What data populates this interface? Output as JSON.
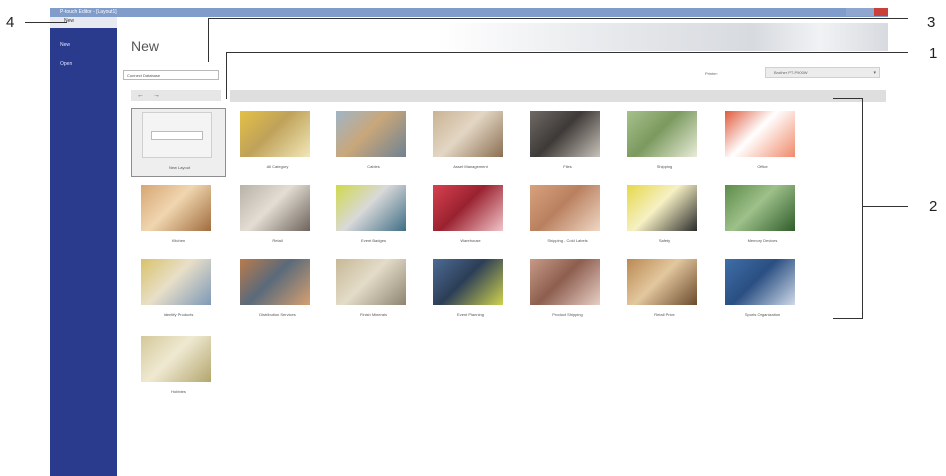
{
  "window": {
    "title": "P-touch Editor - [Layout1]"
  },
  "sidebar": {
    "top_label": "New",
    "items": [
      {
        "label": "New"
      },
      {
        "label": "Open"
      }
    ]
  },
  "main": {
    "title": "New",
    "database_option": "Connect Database",
    "printer_label": "Printer:",
    "printer_value": "Brother PT-P900W",
    "toolbar": {
      "back": "←",
      "forward": "→"
    }
  },
  "templates": [
    {
      "label": "New Layout",
      "icon": "new-layout",
      "colors": [
        "#f4f4f4"
      ]
    },
    {
      "label": "All Category",
      "icon": "photo",
      "colors": [
        "#e4c047",
        "#f2e7b8",
        "#bfa25a"
      ]
    },
    {
      "label": "Cables",
      "icon": "photo",
      "colors": [
        "#9fb5c7",
        "#6e8292",
        "#c9a77a"
      ]
    },
    {
      "label": "Asset Management",
      "icon": "photo",
      "colors": [
        "#c9b393",
        "#8a6f52",
        "#e3d6c4"
      ]
    },
    {
      "label": "Files",
      "icon": "photo",
      "colors": [
        "#6f6a66",
        "#c8c2ba",
        "#3e3a37"
      ]
    },
    {
      "label": "Shipping",
      "icon": "photo",
      "colors": [
        "#a7c08c",
        "#e9ecd9",
        "#7b9a5f"
      ]
    },
    {
      "label": "Office",
      "icon": "photo",
      "colors": [
        "#e05a3c",
        "#f08a6a",
        "#ffffff"
      ]
    },
    {
      "label": "Kitchen",
      "icon": "photo",
      "colors": [
        "#d6a673",
        "#a06d3e",
        "#f0d6b0"
      ]
    },
    {
      "label": "Retail",
      "icon": "photo",
      "colors": [
        "#b7b2a8",
        "#6d645c",
        "#e3ddd3"
      ]
    },
    {
      "label": "Event Badges",
      "icon": "photo",
      "colors": [
        "#cfd94a",
        "#3f6e86",
        "#d9d9d9"
      ]
    },
    {
      "label": "Warehouse",
      "icon": "photo",
      "colors": [
        "#d8404f",
        "#f2c4c8",
        "#9a2230"
      ]
    },
    {
      "label": "Shipping - Cold Labels",
      "icon": "photo",
      "colors": [
        "#d8a27c",
        "#f0d7c3",
        "#b98060"
      ]
    },
    {
      "label": "Safety",
      "icon": "photo",
      "colors": [
        "#e6d84a",
        "#2b2b2b",
        "#f6f0c4"
      ]
    },
    {
      "label": "Memory Devices",
      "icon": "photo",
      "colors": [
        "#5c8c4a",
        "#2f5d2a",
        "#9ec08a"
      ]
    },
    {
      "label": "Identify Products",
      "icon": "photo",
      "colors": [
        "#d9c26a",
        "#7d99b8",
        "#e8dfc8"
      ]
    },
    {
      "label": "Distribution Services",
      "icon": "photo",
      "colors": [
        "#b97b4c",
        "#d6a070",
        "#5a6a7a"
      ]
    },
    {
      "label": "Finish Minerals",
      "icon": "photo",
      "colors": [
        "#c7b896",
        "#8e8470",
        "#e3dcc9"
      ]
    },
    {
      "label": "Event Planning",
      "icon": "photo",
      "colors": [
        "#4d6b94",
        "#cfd24d",
        "#2c3e57"
      ]
    },
    {
      "label": "Product Shipping",
      "icon": "photo",
      "colors": [
        "#c79a86",
        "#e8cfc5",
        "#8d5e4f"
      ]
    },
    {
      "label": "Retail Price",
      "icon": "photo",
      "colors": [
        "#b98a52",
        "#6b4a2c",
        "#e3c79e"
      ]
    },
    {
      "label": "Sports Organization",
      "icon": "photo",
      "colors": [
        "#3f6ea8",
        "#cfd9e8",
        "#2a4f82"
      ]
    },
    {
      "label": "Hobbies",
      "icon": "photo",
      "colors": [
        "#d4c89a",
        "#b2a66d",
        "#efe9d2"
      ]
    }
  ],
  "callouts": {
    "c1": "1",
    "c2": "2",
    "c3": "3",
    "c4": "4"
  }
}
